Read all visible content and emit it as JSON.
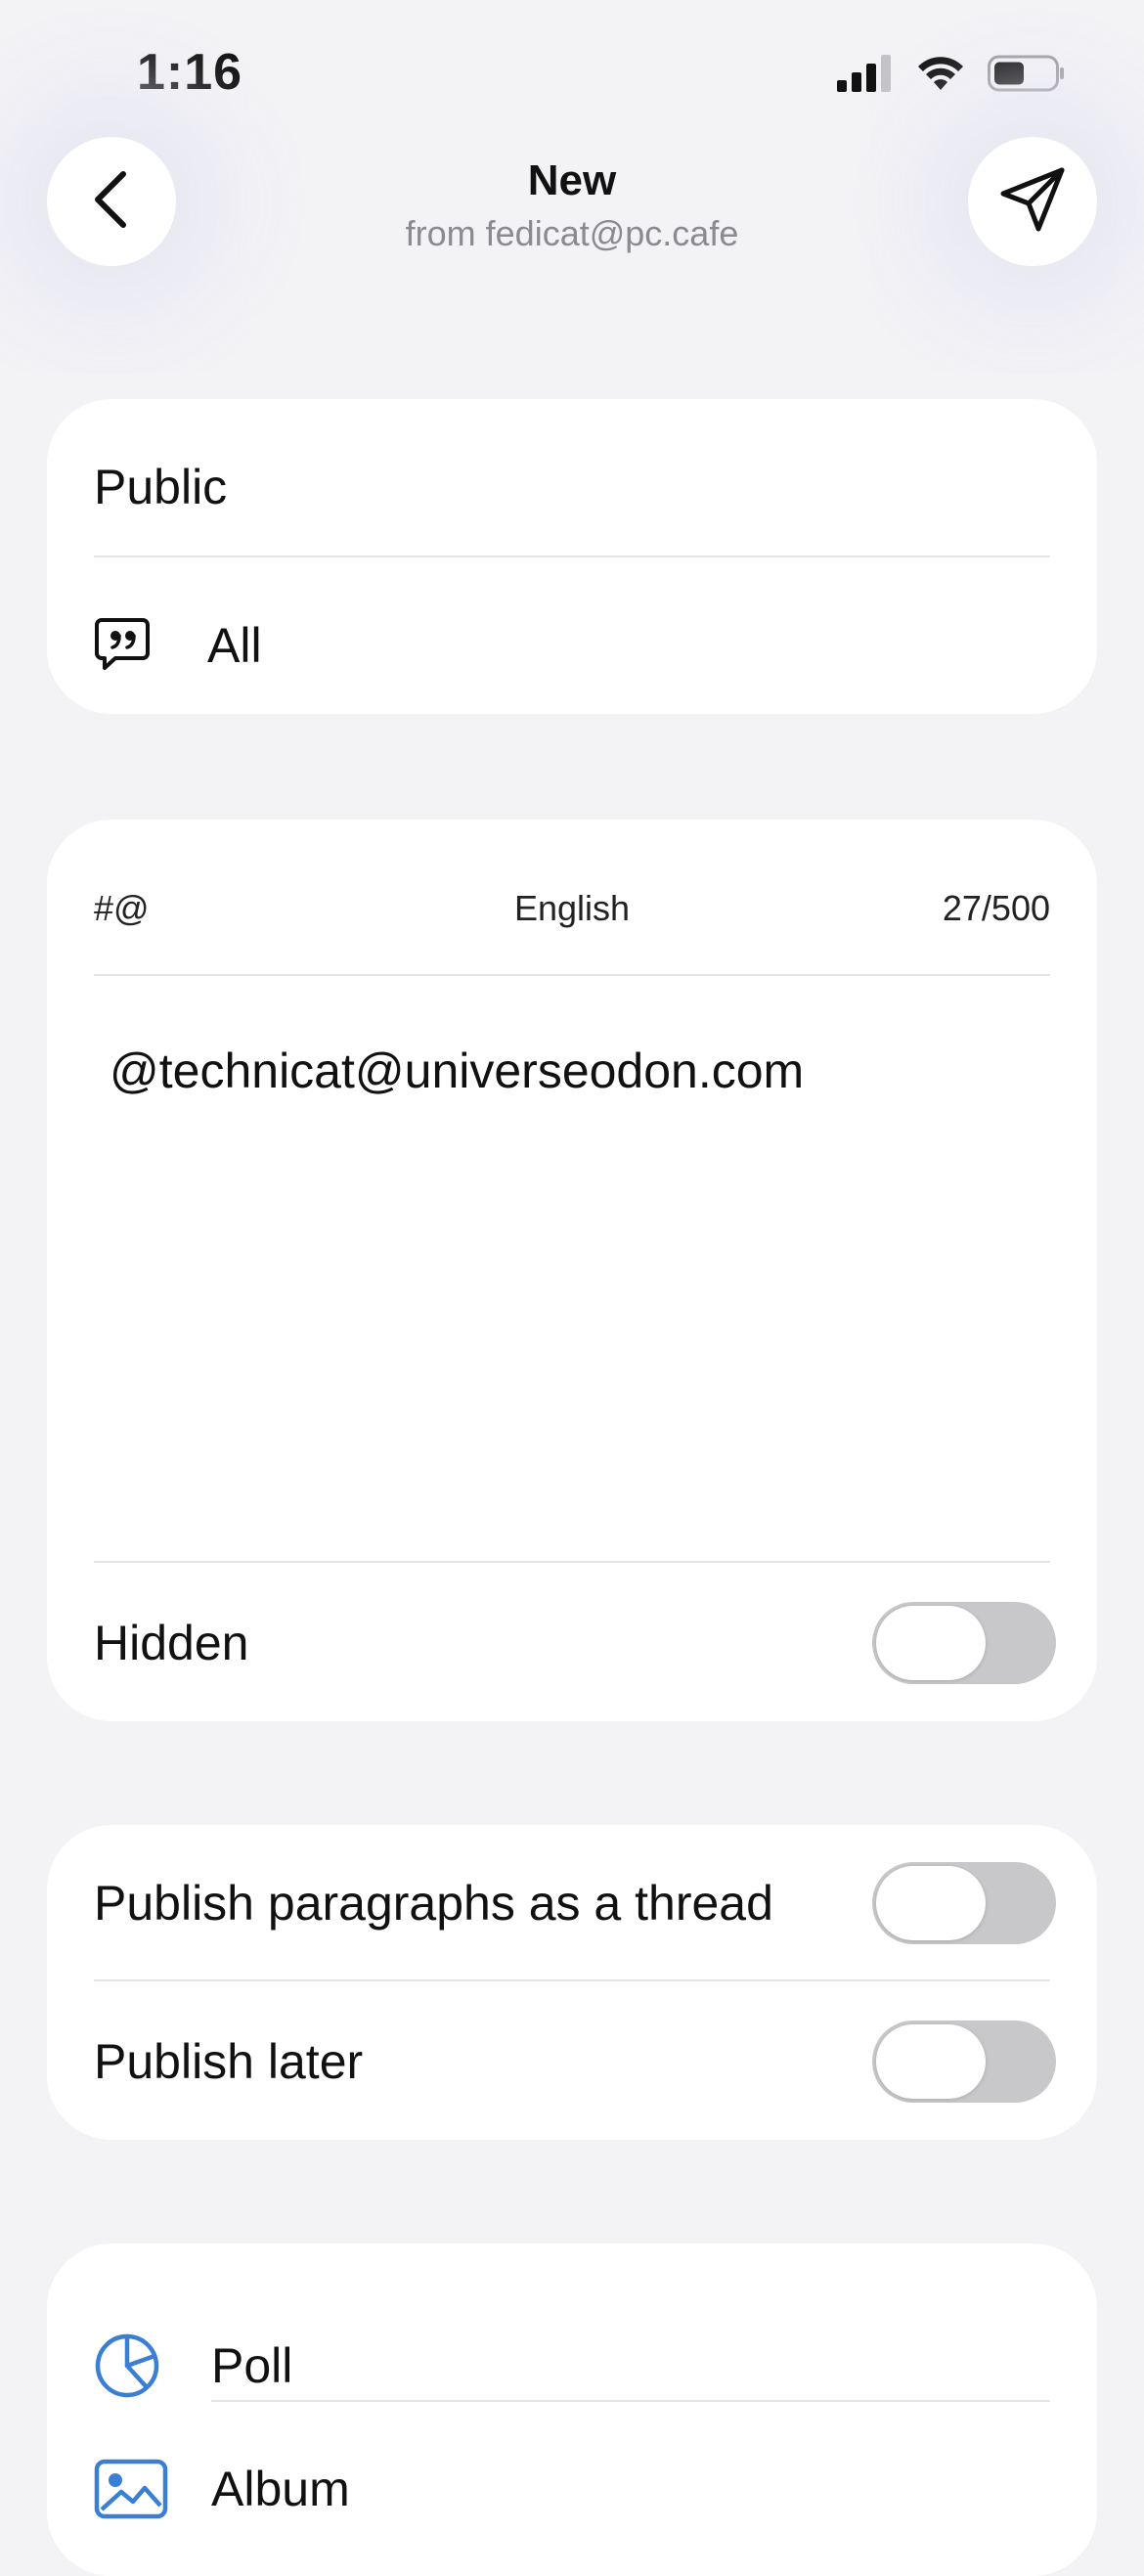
{
  "status": {
    "time": "1:16"
  },
  "header": {
    "title": "New",
    "subtitle": "from fedicat@pc.cafe"
  },
  "visibility_card": {
    "visibility": "Public",
    "reply_scope": "All"
  },
  "compose_card": {
    "tag_shortcut": "#@",
    "language": "English",
    "char_count": "27/500",
    "text": "@technicat@universeodon.com",
    "hidden_label": "Hidden"
  },
  "options_card": {
    "thread_label": "Publish paragraphs as a thread",
    "later_label": "Publish later"
  },
  "attachments_card": {
    "poll_label": "Poll",
    "album_label": "Album"
  },
  "colors": {
    "accent": "#3b7fd4",
    "background": "#f3f3f6",
    "toggle_off": "#c8c8cb"
  }
}
